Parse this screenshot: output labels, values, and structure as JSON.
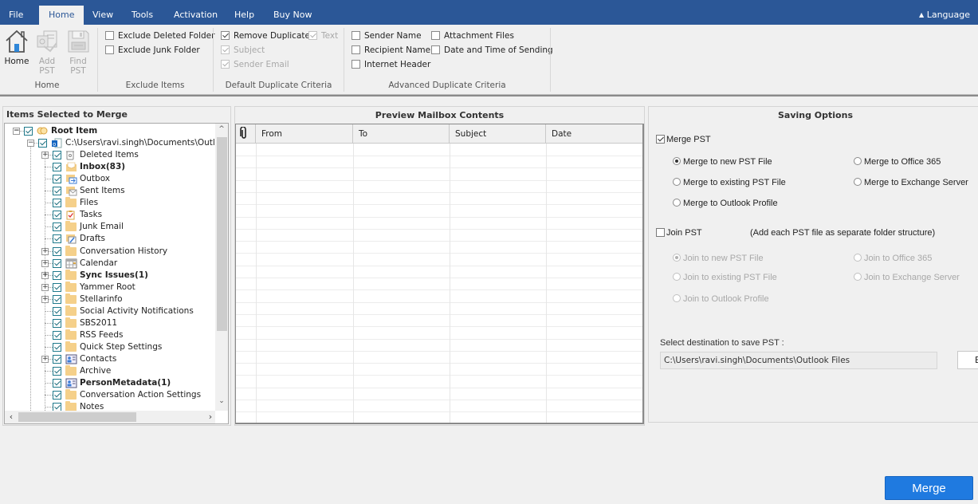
{
  "menubar": {
    "items": [
      {
        "label": "File",
        "active": false
      },
      {
        "label": "Home",
        "active": true
      },
      {
        "label": "View",
        "active": false
      },
      {
        "label": "Tools",
        "active": false
      },
      {
        "label": "Activation",
        "active": false
      },
      {
        "label": "Help",
        "active": false
      },
      {
        "label": "Buy Now",
        "active": false
      }
    ],
    "language_label": "Language",
    "language_icon": "caret-up-icon"
  },
  "ribbon": {
    "home_group": {
      "label": "Home",
      "buttons": [
        {
          "label_line1": "Home",
          "label_line2": "",
          "icon": "home-icon",
          "enabled": true
        },
        {
          "label_line1": "Add",
          "label_line2": "PST",
          "icon": "add-pst-icon",
          "enabled": false
        },
        {
          "label_line1": "Find",
          "label_line2": "PST",
          "icon": "find-pst-icon",
          "enabled": false
        }
      ]
    },
    "exclude_group": {
      "label": "Exclude Items",
      "options": [
        {
          "label": "Exclude Deleted Folder",
          "checked": false,
          "enabled": true
        },
        {
          "label": "Exclude Junk Folder",
          "checked": false,
          "enabled": true
        }
      ]
    },
    "default_criteria_group": {
      "label": "Default Duplicate Criteria",
      "options": [
        {
          "label": "Remove Duplicate",
          "checked": true,
          "enabled": true
        },
        {
          "label": "Text",
          "checked": true,
          "enabled": false
        },
        {
          "label": "Subject",
          "checked": true,
          "enabled": false
        },
        {
          "label": "Sender Email",
          "checked": true,
          "enabled": false
        }
      ]
    },
    "advanced_criteria_group": {
      "label": "Advanced Duplicate Criteria",
      "options": [
        {
          "label": "Sender Name",
          "checked": false
        },
        {
          "label": "Attachment Files",
          "checked": false
        },
        {
          "label": "Recipient Name",
          "checked": false
        },
        {
          "label": "Date and Time of Sending",
          "checked": false
        },
        {
          "label": "Internet Header",
          "checked": false
        }
      ]
    }
  },
  "left_panel": {
    "title": "Items Selected to Merge",
    "tree": [
      {
        "label": "Root Item",
        "level": 0,
        "bold": true,
        "expander": "minus",
        "icon": "root-icon"
      },
      {
        "label": "C:\\Users\\ravi.singh\\Documents\\Outlook Fil",
        "level": 1,
        "bold": false,
        "expander": "minus",
        "icon": "outlook-pst-icon"
      },
      {
        "label": "Deleted Items",
        "level": 2,
        "bold": false,
        "expander": "plus",
        "icon": "trash-icon"
      },
      {
        "label": "Inbox(83)",
        "level": 2,
        "bold": true,
        "expander": "",
        "icon": "inbox-icon"
      },
      {
        "label": "Outbox",
        "level": 2,
        "bold": false,
        "expander": "",
        "icon": "outbox-icon"
      },
      {
        "label": "Sent Items",
        "level": 2,
        "bold": false,
        "expander": "",
        "icon": "sent-items-icon"
      },
      {
        "label": "Files",
        "level": 2,
        "bold": false,
        "expander": "",
        "icon": "folder-icon"
      },
      {
        "label": "Tasks",
        "level": 2,
        "bold": false,
        "expander": "",
        "icon": "tasks-icon"
      },
      {
        "label": "Junk Email",
        "level": 2,
        "bold": false,
        "expander": "",
        "icon": "folder-icon"
      },
      {
        "label": "Drafts",
        "level": 2,
        "bold": false,
        "expander": "",
        "icon": "drafts-icon"
      },
      {
        "label": "Conversation History",
        "level": 2,
        "bold": false,
        "expander": "plus",
        "icon": "folder-icon"
      },
      {
        "label": "Calendar",
        "level": 2,
        "bold": false,
        "expander": "plus",
        "icon": "calendar-icon"
      },
      {
        "label": "Sync Issues(1)",
        "level": 2,
        "bold": true,
        "expander": "plus",
        "icon": "folder-icon"
      },
      {
        "label": "Yammer Root",
        "level": 2,
        "bold": false,
        "expander": "plus",
        "icon": "folder-icon"
      },
      {
        "label": "Stellarinfo",
        "level": 2,
        "bold": false,
        "expander": "plus",
        "icon": "folder-icon"
      },
      {
        "label": "Social Activity Notifications",
        "level": 2,
        "bold": false,
        "expander": "",
        "icon": "folder-icon"
      },
      {
        "label": "SBS2011",
        "level": 2,
        "bold": false,
        "expander": "",
        "icon": "folder-icon"
      },
      {
        "label": "RSS Feeds",
        "level": 2,
        "bold": false,
        "expander": "",
        "icon": "folder-icon"
      },
      {
        "label": "Quick Step Settings",
        "level": 2,
        "bold": false,
        "expander": "",
        "icon": "folder-icon"
      },
      {
        "label": "Contacts",
        "level": 2,
        "bold": false,
        "expander": "plus",
        "icon": "contacts-icon"
      },
      {
        "label": "Archive",
        "level": 2,
        "bold": false,
        "expander": "",
        "icon": "folder-icon"
      },
      {
        "label": "PersonMetadata(1)",
        "level": 2,
        "bold": true,
        "expander": "",
        "icon": "contacts-icon"
      },
      {
        "label": "Conversation Action Settings",
        "level": 2,
        "bold": false,
        "expander": "",
        "icon": "folder-icon"
      },
      {
        "label": "Notes",
        "level": 2,
        "bold": false,
        "expander": "",
        "icon": "folder-icon"
      }
    ]
  },
  "middle_panel": {
    "title": "Preview Mailbox Contents",
    "columns": [
      "",
      "From",
      "To",
      "Subject",
      "Date"
    ],
    "attachment_icon": "paperclip-icon",
    "rows": []
  },
  "right_panel": {
    "title": "Saving Options",
    "merge_pst": {
      "label": "Merge PST",
      "checked": true
    },
    "merge_options": [
      {
        "label": "Merge to new PST File",
        "checked": true
      },
      {
        "label": "Merge to Office 365",
        "checked": false
      },
      {
        "label": "Merge to existing PST File",
        "checked": false
      },
      {
        "label": "Merge to Exchange Server",
        "checked": false
      },
      {
        "label": "Merge to Outlook Profile",
        "checked": false
      }
    ],
    "join_pst": {
      "label": "Join PST",
      "checked": false,
      "note": "(Add each PST file as separate folder structure)"
    },
    "join_options": [
      {
        "label": "Join to new PST File",
        "checked": true
      },
      {
        "label": "Join to Office 365",
        "checked": false
      },
      {
        "label": "Join to existing PST File",
        "checked": false
      },
      {
        "label": "Join to Exchange Server",
        "checked": false
      },
      {
        "label": "Join to Outlook Profile",
        "checked": false
      }
    ],
    "destination_label": "Select destination to save PST :",
    "destination_value": "C:\\Users\\ravi.singh\\Documents\\Outlook Files",
    "browse_label": "B"
  },
  "footer": {
    "merge_label": "Merge",
    "merge_color": "#1f7ae0"
  }
}
